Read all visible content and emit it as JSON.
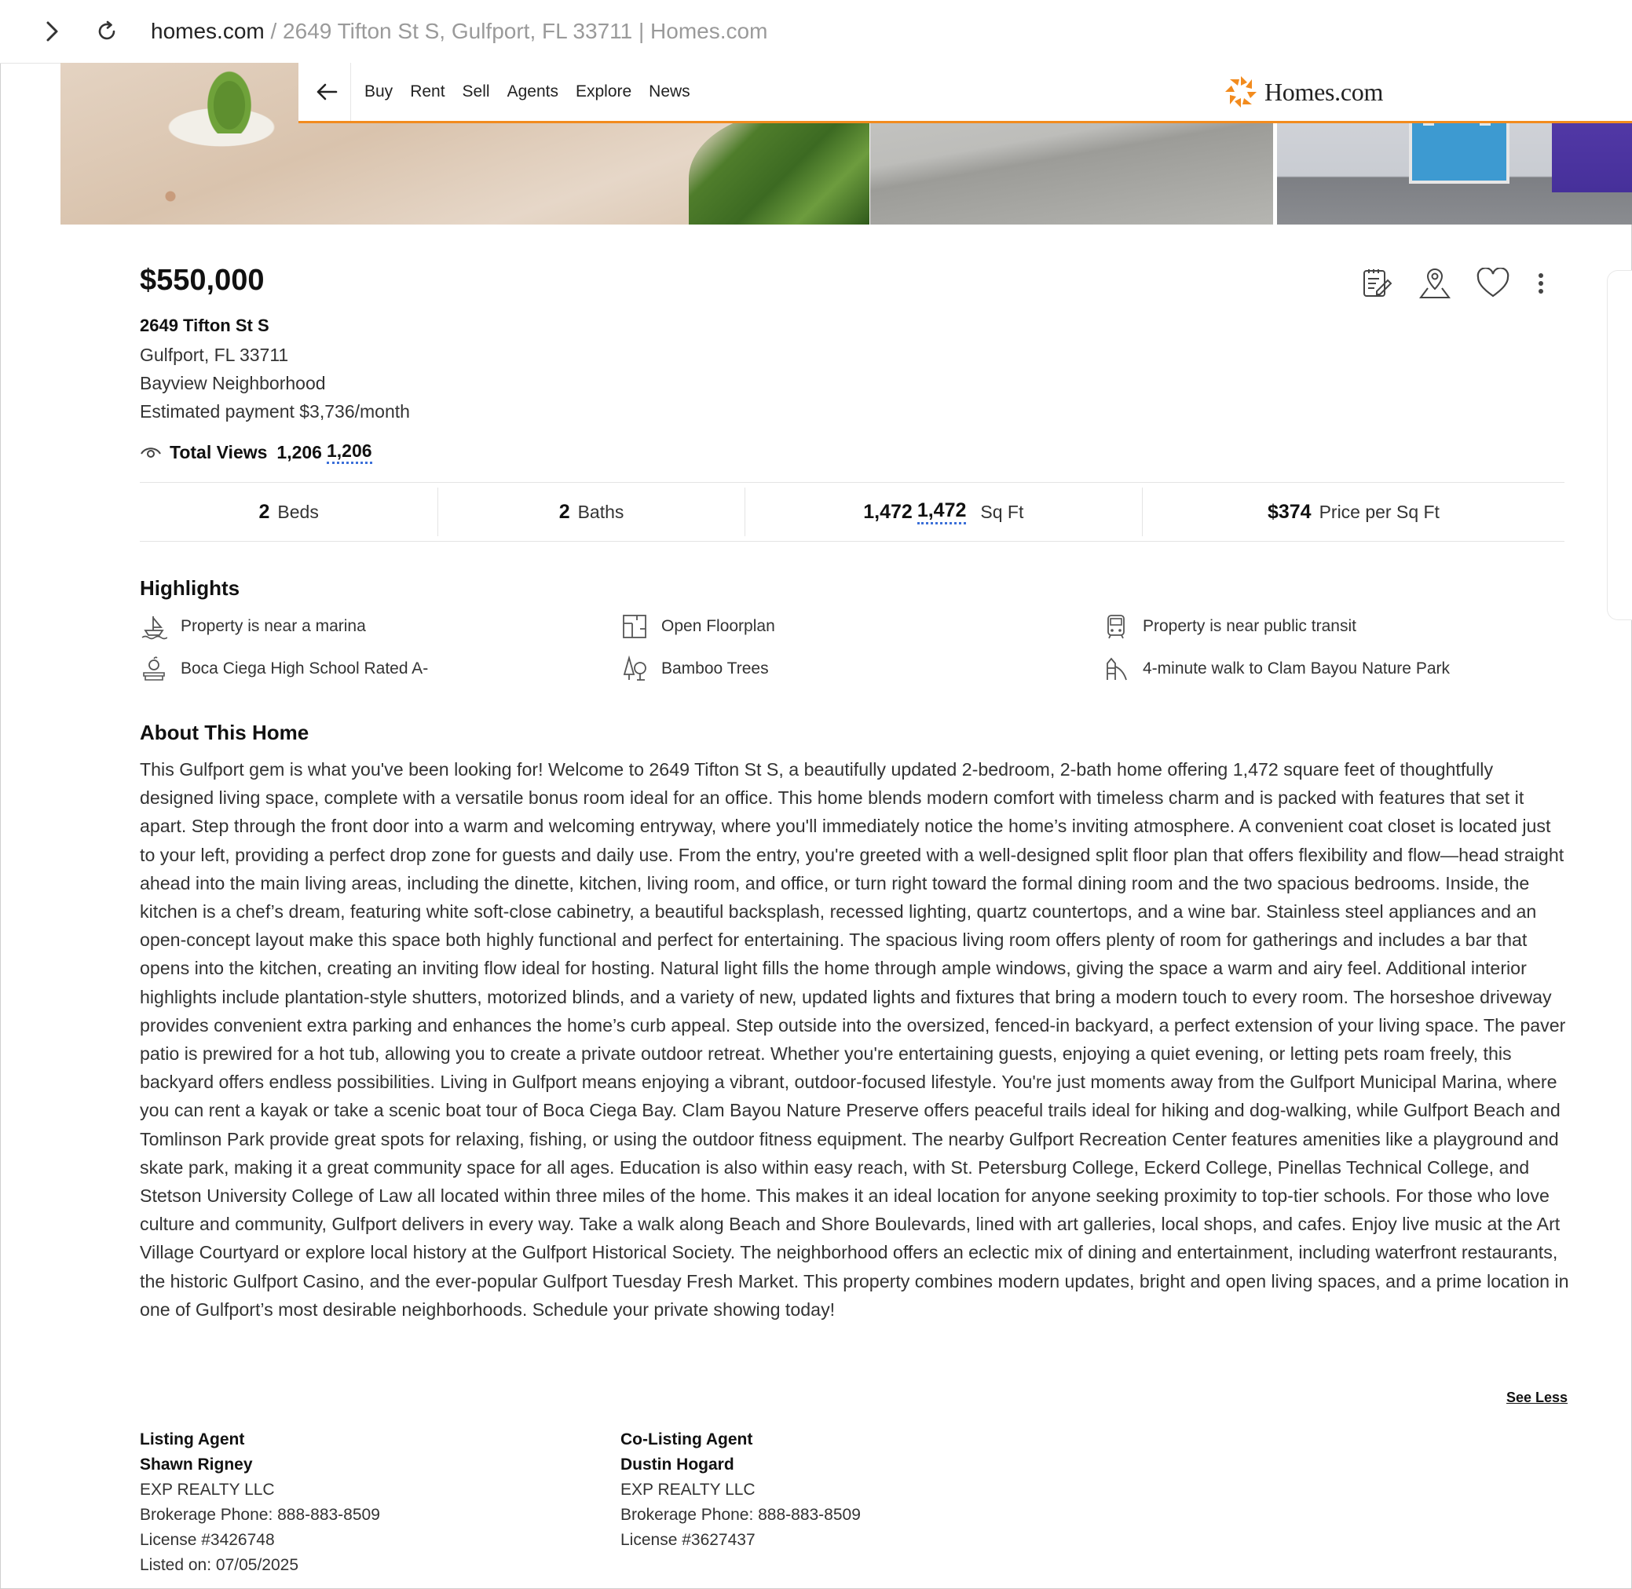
{
  "browser": {
    "url_host": "homes.com",
    "url_rest": " / 2649 Tifton St S, Gulfport, FL 33711 | Homes.com"
  },
  "nav": {
    "links": [
      "Buy",
      "Rent",
      "Sell",
      "Agents",
      "Explore",
      "News"
    ],
    "logo_text": "Homes.com",
    "accent": "#f28b1e"
  },
  "listing": {
    "price": "$550,000",
    "street": "2649 Tifton St S",
    "city_state_zip": "Gulfport, FL 33711",
    "neighborhood": "Bayview Neighborhood",
    "estimated_payment": "Estimated payment $3,736/month",
    "views_label": "Total Views",
    "views_value": "1,206",
    "views_value_dup": "1,206"
  },
  "stats": {
    "beds_value": "2",
    "beds_label": "Beds",
    "baths_value": "2",
    "baths_label": "Baths",
    "sqft_value": "1,472",
    "sqft_value_dup": "1,472",
    "sqft_label": "Sq Ft",
    "ppsf_value": "$374",
    "ppsf_label": "Price per Sq Ft"
  },
  "highlights": {
    "title": "Highlights",
    "items": [
      {
        "label": "Property is near a marina",
        "icon": "marina-icon"
      },
      {
        "label": "Open Floorplan",
        "icon": "floorplan-icon"
      },
      {
        "label": "Property is near public transit",
        "icon": "transit-icon"
      },
      {
        "label": "Boca Ciega High School Rated A-",
        "icon": "school-icon"
      },
      {
        "label": "Bamboo Trees",
        "icon": "trees-icon"
      },
      {
        "label": "4-minute walk to Clam Bayou Nature Park",
        "icon": "playground-icon"
      }
    ]
  },
  "about": {
    "title": "About This Home",
    "text": "This Gulfport gem is what you've been looking for! Welcome to 2649 Tifton St S, a beautifully updated 2-bedroom, 2-bath home offering 1,472 square feet of thoughtfully designed living space, complete with a versatile bonus room ideal for an office. This home blends modern comfort with timeless charm and is packed with features that set it apart. Step through the front door into a warm and welcoming entryway, where you'll immediately notice the home’s inviting atmosphere. A convenient coat closet is located just to your left, providing a perfect drop zone for guests and daily use. From the entry, you're greeted with a well-designed split floor plan that offers flexibility and flow—head straight ahead into the main living areas, including the dinette, kitchen, living room, and office, or turn right toward the formal dining room and the two spacious bedrooms. Inside, the kitchen is a chef’s dream, featuring white soft-close cabinetry, a beautiful backsplash, recessed lighting, quartz countertops, and a wine bar. Stainless steel appliances and an open-concept layout make this space both highly functional and perfect for entertaining. The spacious living room offers plenty of room for gatherings and includes a bar that opens into the kitchen, creating an inviting flow ideal for hosting. Natural light fills the home through ample windows, giving the space a warm and airy feel. Additional interior highlights include plantation-style shutters, motorized blinds, and a variety of new, updated lights and fixtures that bring a modern touch to every room. The horseshoe driveway provides convenient extra parking and enhances the home’s curb appeal. Step outside into the oversized, fenced-in backyard, a perfect extension of your living space. The paver patio is prewired for a hot tub, allowing you to create a private outdoor retreat. Whether you're entertaining guests, enjoying a quiet evening, or letting pets roam freely, this backyard offers endless possibilities. Living in Gulfport means enjoying a vibrant, outdoor-focused lifestyle. You're just moments away from the Gulfport Municipal Marina, where you can rent a kayak or take a scenic boat tour of Boca Ciega Bay. Clam Bayou Nature Preserve offers peaceful trails ideal for hiking and dog-walking, while Gulfport Beach and Tomlinson Park provide great spots for relaxing, fishing, or using the outdoor fitness equipment. The nearby Gulfport Recreation Center features amenities like a playground and skate park, making it a great community space for all ages. Education is also within easy reach, with St. Petersburg College, Eckerd College, Pinellas Technical College, and Stetson University College of Law all located within three miles of the home. This makes it an ideal location for anyone seeking proximity to top-tier schools. For those who love culture and community, Gulfport delivers in every way. Take a walk along Beach and Shore Boulevards, lined with art galleries, local shops, and cafes. Enjoy live music at the Art Village Courtyard or explore local history at the Gulfport Historical Society. The neighborhood offers an eclectic mix of dining and entertainment, including waterfront restaurants, the historic Gulfport Casino, and the ever-popular Gulfport Tuesday Fresh Market. This property combines modern updates, bright and open living spaces, and a prime location in one of Gulfport’s most desirable neighborhoods. Schedule your private showing today!",
    "see_less": "See Less"
  },
  "listing_agent": {
    "heading": "Listing Agent",
    "name": "Shawn Rigney",
    "brokerage": "EXP REALTY LLC",
    "phone": "Brokerage Phone: 888-883-8509",
    "license": "License #3426748",
    "listed_on": "Listed on: 07/05/2025"
  },
  "co_listing_agent": {
    "heading": "Co-Listing Agent",
    "name": "Dustin Hogard",
    "brokerage": "EXP REALTY LLC",
    "phone": "Brokerage Phone: 888-883-8509",
    "license": "License #3627437"
  }
}
